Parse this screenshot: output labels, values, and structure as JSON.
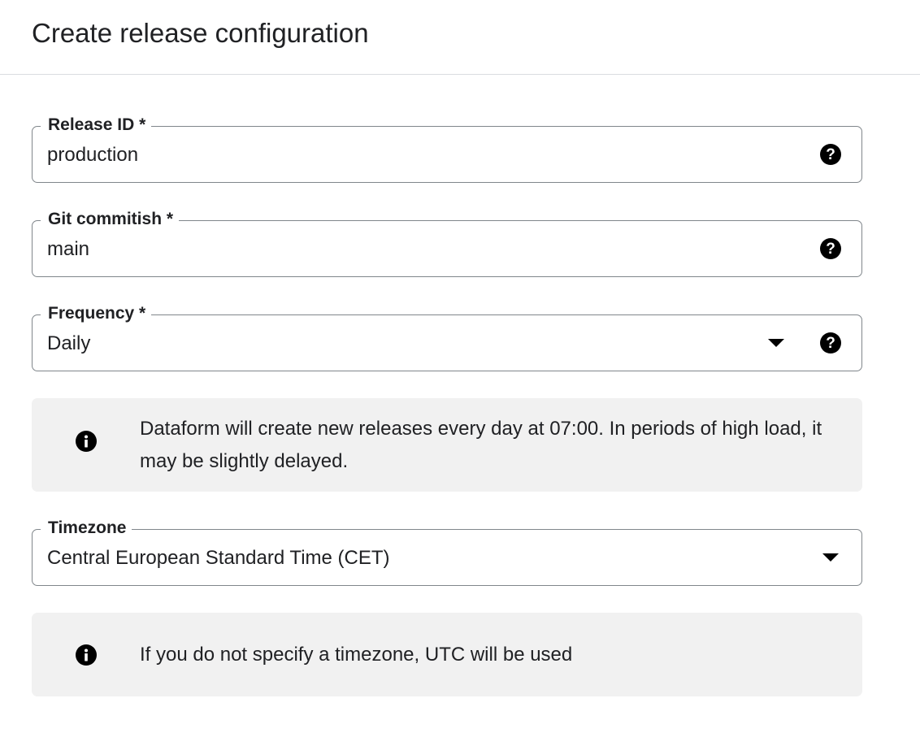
{
  "dialog": {
    "title": "Create release configuration"
  },
  "fields": {
    "release_id": {
      "label": "Release ID *",
      "value": "production",
      "help_icon": "help-circle-icon"
    },
    "git_commitish": {
      "label": "Git commitish *",
      "value": "main",
      "help_icon": "help-circle-icon"
    },
    "frequency": {
      "label": "Frequency *",
      "value": "Daily",
      "dropdown_icon": "caret-down-icon",
      "help_icon": "help-circle-icon"
    },
    "timezone": {
      "label": "Timezone",
      "value": "Central European Standard Time (CET)",
      "dropdown_icon": "caret-down-icon"
    }
  },
  "info": {
    "frequency_note": {
      "icon": "info-icon",
      "text": "Dataform will create new releases every day at 07:00. In periods of high load, it may be slightly delayed."
    },
    "timezone_note": {
      "icon": "info-icon",
      "text": "If you do not specify a timezone, UTC will be used"
    }
  },
  "colors": {
    "field_border": "#80868b",
    "info_background": "#f1f1f1",
    "text": "#202124",
    "divider": "#dadce0"
  }
}
